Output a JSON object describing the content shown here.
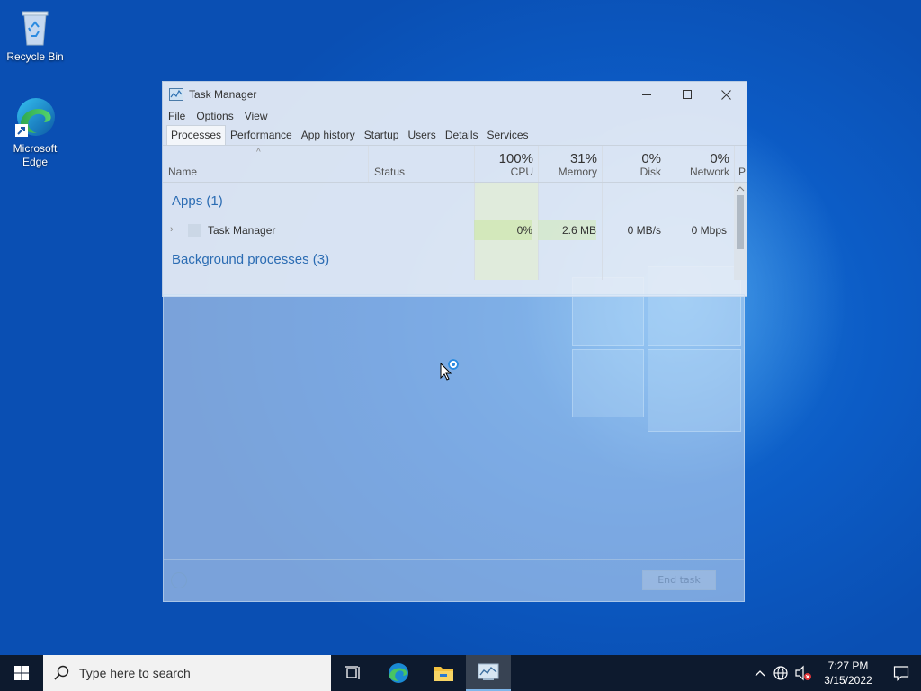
{
  "desktop": {
    "icons": [
      {
        "label": "Recycle Bin",
        "icon": "recycle-bin-icon"
      },
      {
        "label": "Microsoft Edge",
        "icon": "edge-icon"
      }
    ]
  },
  "task_manager": {
    "title": "Task Manager",
    "menu": [
      "File",
      "Options",
      "View"
    ],
    "tabs": [
      "Processes",
      "Performance",
      "App history",
      "Startup",
      "Users",
      "Details",
      "Services"
    ],
    "active_tab": "Processes",
    "columns": {
      "name": "Name",
      "status": "Status",
      "cpu": {
        "pct": "100%",
        "label": "CPU"
      },
      "memory": {
        "pct": "31%",
        "label": "Memory"
      },
      "disk": {
        "pct": "0%",
        "label": "Disk"
      },
      "network": {
        "pct": "0%",
        "label": "Network"
      },
      "power": "P"
    },
    "groups": {
      "apps": "Apps (1)",
      "background": "Background processes (3)"
    },
    "rows": [
      {
        "name": "Task Manager",
        "status": "",
        "cpu": "0%",
        "memory": "2.6 MB",
        "disk": "0 MB/s",
        "network": "0 Mbps"
      }
    ],
    "footer": {
      "end_task": "End task"
    }
  },
  "taskbar": {
    "search_placeholder": "Type here to search",
    "time": "7:27 PM",
    "date": "3/15/2022",
    "pinned": [
      "task-view-icon",
      "edge-icon",
      "file-explorer-icon",
      "task-manager-icon"
    ]
  },
  "colors": {
    "wallpaper": "#0c5cc6",
    "taskbar": "#0d1a2e",
    "group_text": "#2b6cb3",
    "cpu_highlight": "#c8e6a8"
  }
}
